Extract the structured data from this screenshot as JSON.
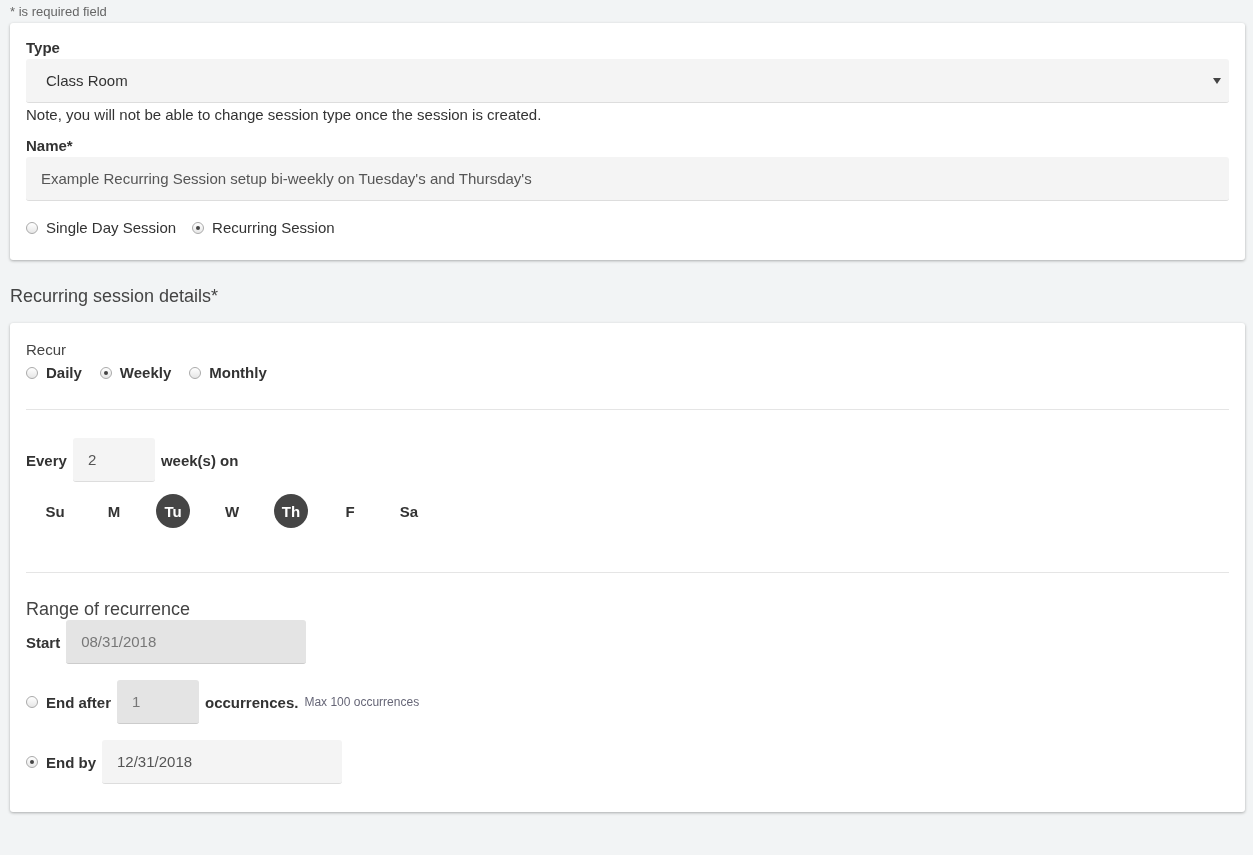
{
  "required_note": "* is required field",
  "session": {
    "type_label": "Type",
    "type_value": "Class Room",
    "type_note": "Note, you will not be able to change session type once the session is created.",
    "name_label": "Name*",
    "name_value": "Example Recurring Session setup bi-weekly on Tuesday's and Thursday's",
    "session_kinds": [
      {
        "label": "Single Day Session",
        "selected": false
      },
      {
        "label": "Recurring Session",
        "selected": true
      }
    ]
  },
  "recurring_title": "Recurring session details*",
  "recur": {
    "label": "Recur",
    "options": [
      {
        "label": "Daily",
        "selected": false
      },
      {
        "label": "Weekly",
        "selected": true
      },
      {
        "label": "Monthly",
        "selected": false
      }
    ]
  },
  "every": {
    "label": "Every",
    "value": "2",
    "suffix": "week(s) on"
  },
  "days": [
    {
      "label": "Su",
      "selected": false
    },
    {
      "label": "M",
      "selected": false
    },
    {
      "label": "Tu",
      "selected": true
    },
    {
      "label": "W",
      "selected": false
    },
    {
      "label": "Th",
      "selected": true
    },
    {
      "label": "F",
      "selected": false
    },
    {
      "label": "Sa",
      "selected": false
    }
  ],
  "range": {
    "title": "Range of recurrence",
    "start_label": "Start",
    "start_value": "08/31/2018",
    "start_disabled": true,
    "end_options": [
      {
        "kind": "after",
        "label": "End after",
        "value": "1",
        "suffix": "occurrences.",
        "hint": "Max 100 occurrences",
        "selected": false,
        "disabled": true
      },
      {
        "kind": "by",
        "label": "End by",
        "value": "12/31/2018",
        "selected": true,
        "disabled": false
      }
    ]
  }
}
